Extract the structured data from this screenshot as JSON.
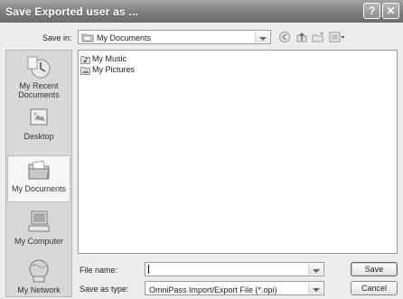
{
  "dialog": {
    "title": "Save Exported user as ...",
    "help_label": "?",
    "close_label": "✕"
  },
  "save_in": {
    "label": "Save in:",
    "value": "My Documents"
  },
  "sidebar": {
    "items": [
      {
        "label": "My Recent Documents",
        "icon": "recent-documents-icon"
      },
      {
        "label": "Desktop",
        "icon": "desktop-icon"
      },
      {
        "label": "My Documents",
        "icon": "my-documents-icon",
        "selected": true
      },
      {
        "label": "My Computer",
        "icon": "my-computer-icon"
      },
      {
        "label": "My Network",
        "icon": "my-network-icon"
      }
    ]
  },
  "files": [
    {
      "name": "My Music",
      "icon": "music-folder-icon"
    },
    {
      "name": "My Pictures",
      "icon": "pictures-folder-icon"
    }
  ],
  "file_name": {
    "label": "File name:",
    "value": ""
  },
  "save_as_type": {
    "label": "Save as type:",
    "value": "OmniPass Import/Export File (*.opi)"
  },
  "buttons": {
    "save": "Save",
    "cancel": "Cancel"
  }
}
